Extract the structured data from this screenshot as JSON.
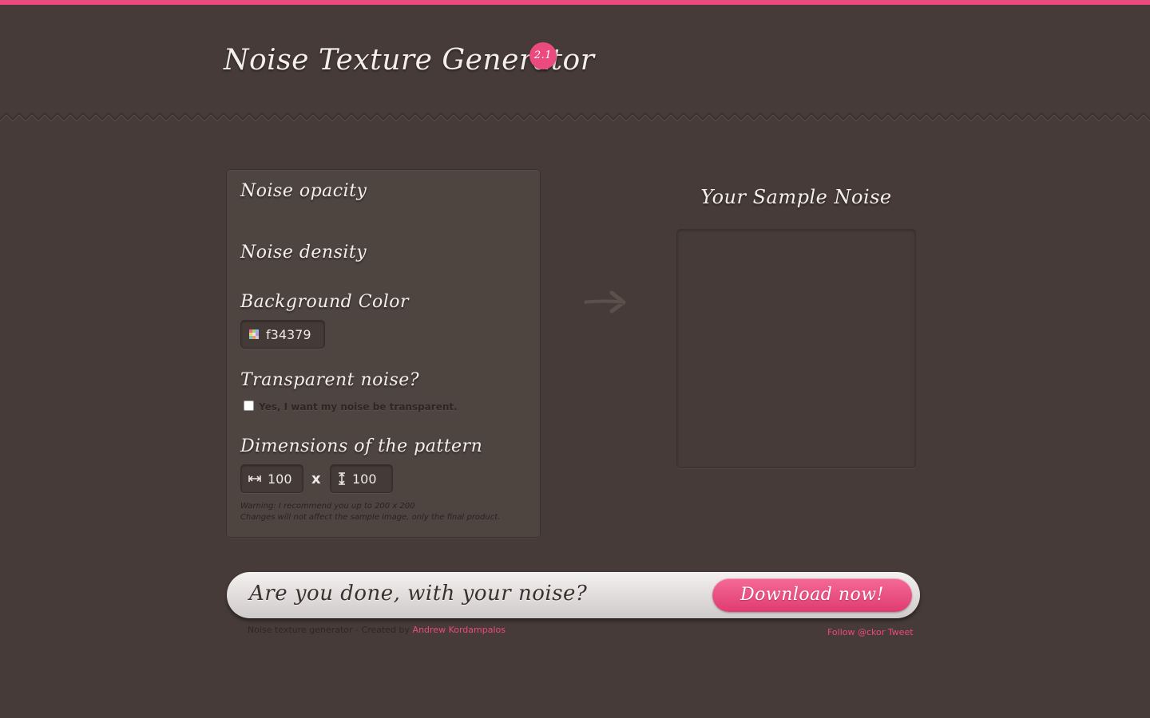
{
  "header": {
    "title": "Noise Texture Generator",
    "version": "2.1"
  },
  "settings": {
    "opacity_label": "Noise opacity",
    "density_label": "Noise density",
    "bg_color_label": "Background Color",
    "bg_color_value": "f34379",
    "transparent_label": "Transparent noise?",
    "transparent_checkbox_label": "Yes, I want my noise be transparent.",
    "transparent_checked": false,
    "dimensions_label": "Dimensions of the pattern",
    "width_value": "100",
    "height_value": "100",
    "times_symbol": "x",
    "warning_line1": "Warning: I recommend you up to 200 x 200",
    "warning_line2": "Changes will not affect the sample image, only the final product."
  },
  "sample": {
    "title": "Your Sample Noise"
  },
  "cta": {
    "question": "Are you done, with your noise?",
    "download_label": "Download now!"
  },
  "footer": {
    "credit_prefix": "Noise texture generator - Created by",
    "author_link": "Andrew Kordampalos",
    "follow_link": "Follow @ckor",
    "tweet_link": "Tweet"
  },
  "colors": {
    "accent": "#ea4a7e",
    "background": "#463b38",
    "panel": "#4e4440"
  }
}
